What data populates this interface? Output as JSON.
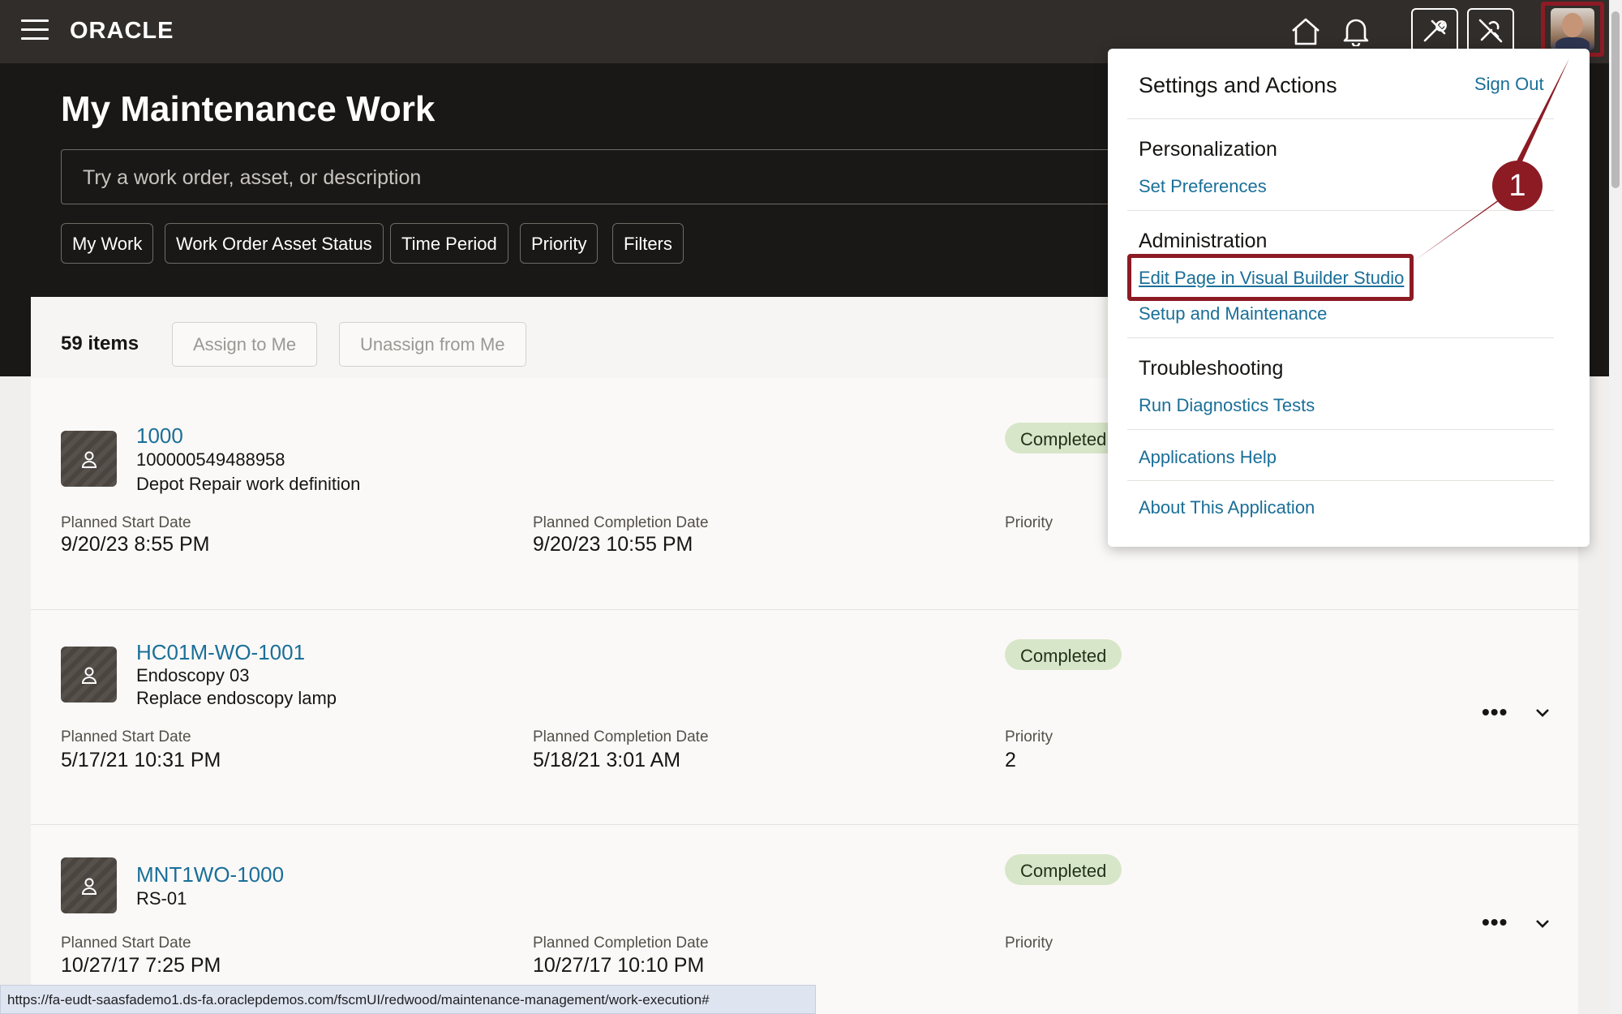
{
  "header": {
    "logo": "ORACLE"
  },
  "page": {
    "title": "My Maintenance Work",
    "search_placeholder": "Try a work order, asset, or description"
  },
  "filters": [
    "My Work",
    "Work Order Asset Status",
    "Time Period",
    "Priority",
    "Filters"
  ],
  "list": {
    "count_label": "59 items",
    "assign_label": "Assign to Me",
    "unassign_label": "Unassign from Me",
    "labels": {
      "start": "Planned Start Date",
      "completion": "Planned Completion Date",
      "priority": "Priority"
    },
    "work_orders": [
      {
        "number": "1000",
        "asset": "100000549488958",
        "description": "Depot Repair work definition",
        "status": "Completed",
        "start": "9/20/23 8:55 PM",
        "completion": "9/20/23 10:55 PM",
        "priority": ""
      },
      {
        "number": "HC01M-WO-1001",
        "asset": "Endoscopy 03",
        "description": "Replace endoscopy lamp",
        "status": "Completed",
        "start": "5/17/21 10:31 PM",
        "completion": "5/18/21 3:01 AM",
        "priority": "2"
      },
      {
        "number": "MNT1WO-1000",
        "asset": "RS-01",
        "description": "",
        "status": "Completed",
        "start": "10/27/17 7:25 PM",
        "completion": "10/27/17 10:10 PM",
        "priority": ""
      }
    ]
  },
  "settings_menu": {
    "title": "Settings and Actions",
    "sign_out": "Sign Out",
    "personalization": {
      "heading": "Personalization",
      "set_preferences": "Set Preferences"
    },
    "administration": {
      "heading": "Administration",
      "edit_page": "Edit Page in Visual Builder Studio",
      "setup": "Setup and Maintenance"
    },
    "troubleshooting": {
      "heading": "Troubleshooting",
      "diagnostics": "Run Diagnostics Tests"
    },
    "applications_help": "Applications Help",
    "about": "About This Application"
  },
  "annotation": {
    "step": "1",
    "color": "#8c1b24"
  },
  "statusbar": {
    "url": "https://fa-eudt-saasfademo1.ds-fa.oraclepdemos.com/fscmUI/redwood/maintenance-management/work-execution#"
  },
  "colors": {
    "link": "#1a6f98",
    "badge_bg": "#d7e6c8",
    "topbar": "#312d2a"
  }
}
